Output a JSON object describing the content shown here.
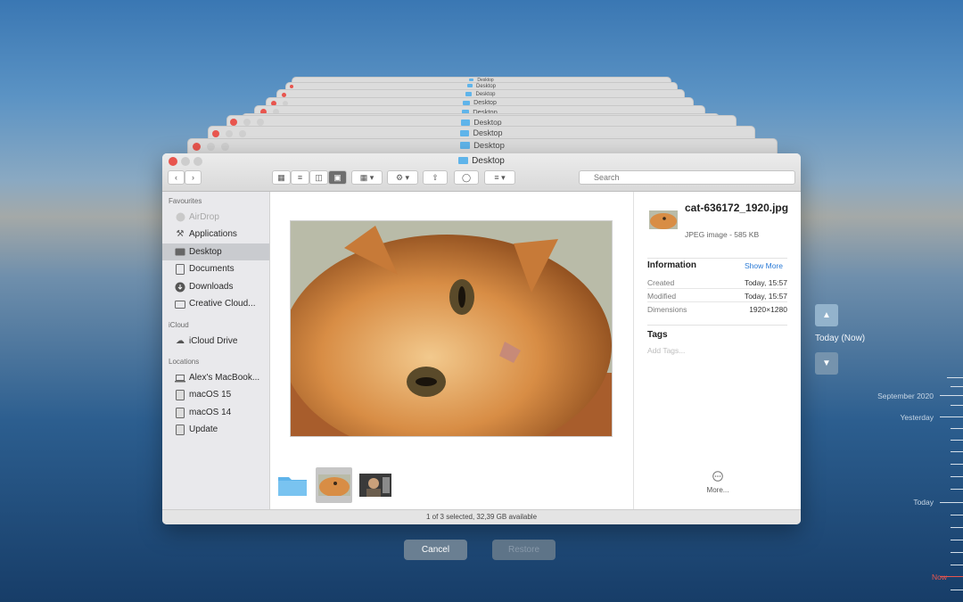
{
  "stack_window_title": "Desktop",
  "window": {
    "title": "Desktop",
    "search_placeholder": "Search",
    "status": "1 of 3 selected, 32,39 GB available"
  },
  "sidebar": {
    "favourites_label": "Favourites",
    "favourites": [
      {
        "label": "AirDrop",
        "icon": "airdrop-icon"
      },
      {
        "label": "Applications",
        "icon": "applications-icon"
      },
      {
        "label": "Desktop",
        "icon": "desktop-icon"
      },
      {
        "label": "Documents",
        "icon": "documents-icon"
      },
      {
        "label": "Downloads",
        "icon": "downloads-icon"
      },
      {
        "label": "Creative Cloud...",
        "icon": "folder-icon"
      }
    ],
    "icloud_label": "iCloud",
    "icloud": [
      {
        "label": "iCloud Drive",
        "icon": "cloud-icon"
      }
    ],
    "locations_label": "Locations",
    "locations": [
      {
        "label": "Alex's MacBook...",
        "icon": "laptop-icon"
      },
      {
        "label": "macOS 15",
        "icon": "disk-icon"
      },
      {
        "label": "macOS 14",
        "icon": "disk-icon"
      },
      {
        "label": "Update",
        "icon": "disk-icon"
      }
    ]
  },
  "inspector": {
    "filename": "cat-636172_1920.jpg",
    "filetype": "JPEG image - 585 KB",
    "info_heading": "Information",
    "show_more": "Show More",
    "rows": [
      {
        "key": "Created",
        "value": "Today, 15:57"
      },
      {
        "key": "Modified",
        "value": "Today, 15:57"
      },
      {
        "key": "Dimensions",
        "value": "1920×1280"
      }
    ],
    "tags_heading": "Tags",
    "tags_placeholder": "Add Tags...",
    "more_label": "More..."
  },
  "buttons": {
    "cancel": "Cancel",
    "restore": "Restore"
  },
  "timemachine": {
    "current_label": "Today (Now)",
    "timeline": [
      "September 2020",
      "Yesterday",
      "Today",
      "Now"
    ]
  },
  "colors": {
    "accent": "#2a7ad6",
    "now": "#e8554e",
    "selection": "#c9cbcf"
  }
}
